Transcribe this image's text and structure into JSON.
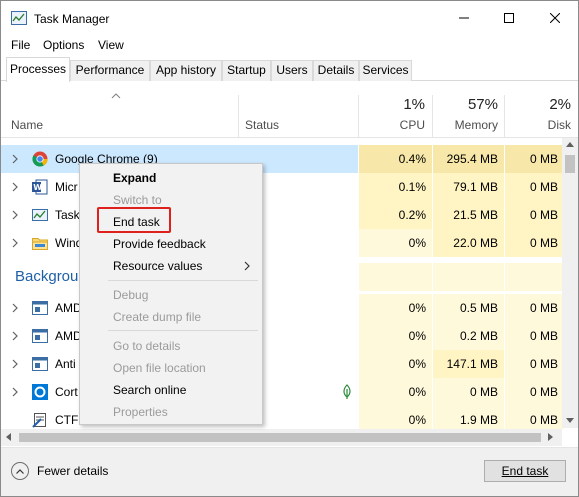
{
  "window": {
    "title": "Task Manager"
  },
  "menu": [
    "File",
    "Options",
    "View"
  ],
  "tabs": [
    "Processes",
    "Performance",
    "App history",
    "Startup",
    "Users",
    "Details",
    "Services"
  ],
  "columns": {
    "name": "Name",
    "status": "Status",
    "cpu": {
      "pct": "1%",
      "label": "CPU"
    },
    "memory": {
      "pct": "57%",
      "label": "Memory"
    },
    "disk": {
      "pct": "2%",
      "label": "Disk"
    }
  },
  "apps": [
    {
      "name": "Google Chrome (9)",
      "icon": "chrome-icon",
      "cpu": "0.4%",
      "mem": "295.4 MB",
      "disk": "0 MB"
    },
    {
      "name": "Micr",
      "icon": "word-icon",
      "cpu": "0.1%",
      "mem": "79.1 MB",
      "disk": "0 MB"
    },
    {
      "name": "Task",
      "icon": "task-manager-icon",
      "cpu": "0.2%",
      "mem": "21.5 MB",
      "disk": "0 MB"
    },
    {
      "name": "Wind",
      "icon": "folder-icon",
      "cpu": "0%",
      "mem": "22.0 MB",
      "disk": "0 MB"
    }
  ],
  "background_section": "Backgrou",
  "background": [
    {
      "name": "AMD",
      "icon": "app-window-icon",
      "cpu": "0%",
      "mem": "0.5 MB",
      "disk": "0 MB"
    },
    {
      "name": "AMD",
      "icon": "app-window-icon",
      "cpu": "0%",
      "mem": "0.2 MB",
      "disk": "0 MB"
    },
    {
      "name": "Anti",
      "icon": "app-window-icon",
      "cpu": "0%",
      "mem": "147.1 MB",
      "disk": "0 MB"
    },
    {
      "name": "Cort",
      "icon": "cortana-icon",
      "cpu": "0%",
      "mem": "0 MB",
      "disk": "0 MB"
    },
    {
      "name": "CTF",
      "icon": "ctf-loader-icon",
      "cpu": "0%",
      "mem": "1.9 MB",
      "disk": "0 MB"
    }
  ],
  "context_menu": {
    "expand": "Expand",
    "switch_to": "Switch to",
    "end_task": "End task",
    "provide_feedback": "Provide feedback",
    "resource_values": "Resource values",
    "debug": "Debug",
    "create_dump": "Create dump file",
    "go_to_details": "Go to details",
    "open_file_location": "Open file location",
    "search_online": "Search online",
    "properties": "Properties"
  },
  "footer": {
    "fewer_details": "Fewer details",
    "end_task": "End task"
  },
  "colors": {
    "accent": "#1e5fa8",
    "selection": "#cce8ff",
    "heat": "#fff4c4",
    "highlight": "#e0201c"
  }
}
